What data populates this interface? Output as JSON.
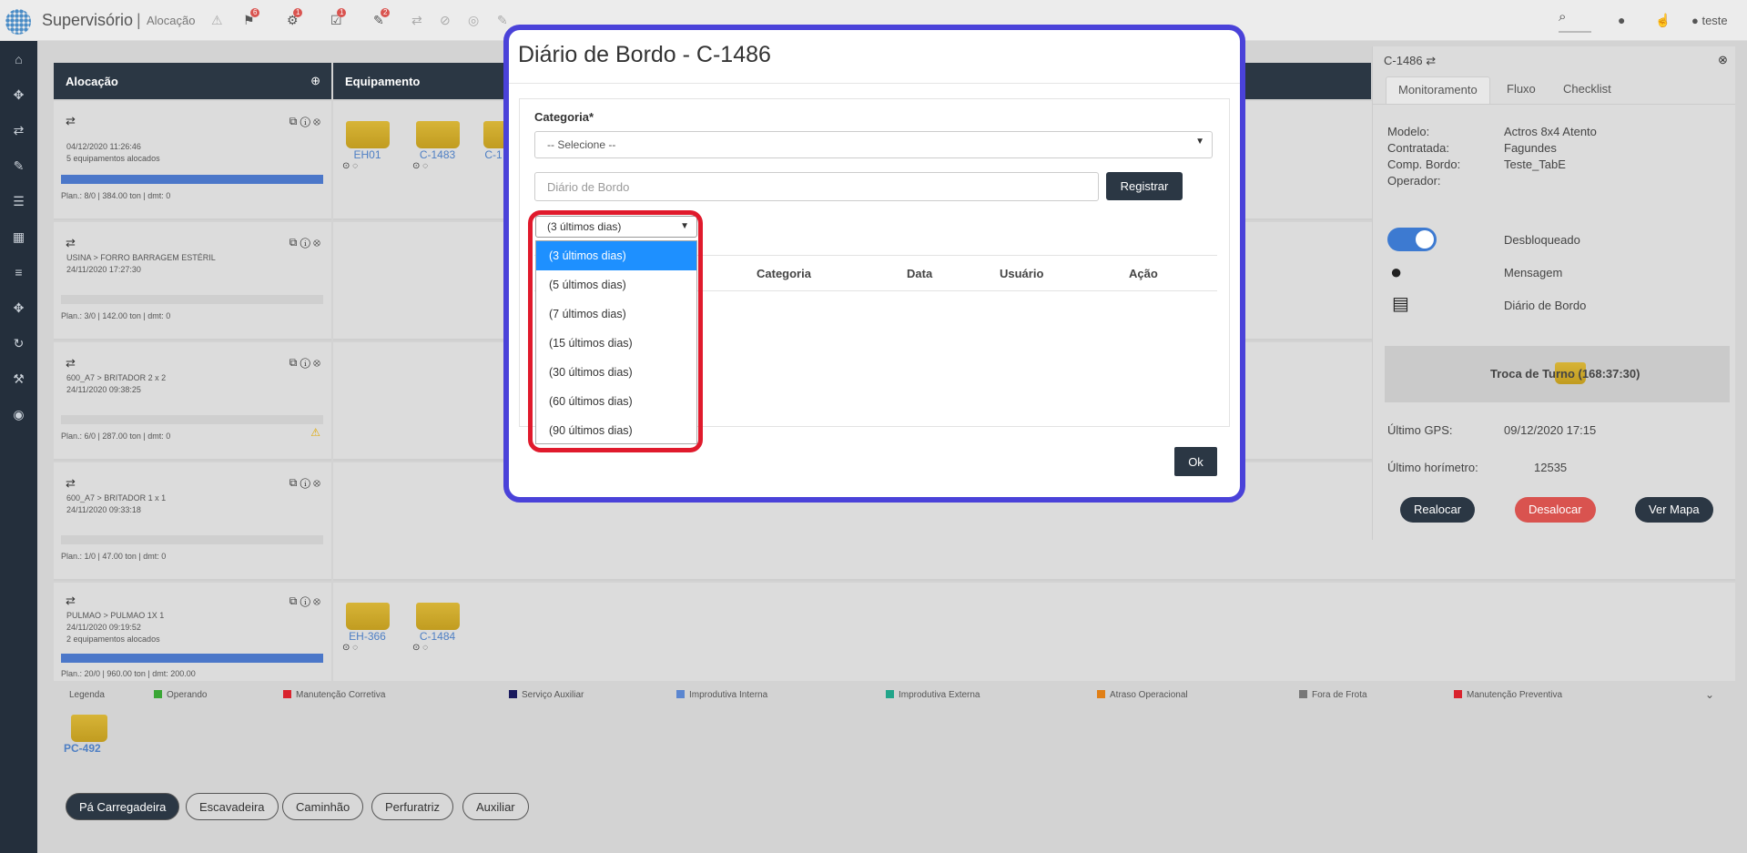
{
  "topbar": {
    "title": "Supervisório",
    "separator": "|",
    "subtitle": "Alocação",
    "badges": [
      "6",
      "1",
      "1",
      "2"
    ],
    "user": "teste"
  },
  "allocation": {
    "header": "Alocação",
    "equipment_header": "Equipamento",
    "rows": [
      {
        "line1": "04/12/2020 11:26:46",
        "line2": "5 equipamentos alocados",
        "plan": "Plan.: 8/0 | 384.00 ton | dmt: 0",
        "progress": 1.0
      },
      {
        "line1": "USINA > FORRO BARRAGEM ESTÉRIL",
        "line2": "24/11/2020 17:27:30",
        "plan": "Plan.: 3/0 | 142.00 ton | dmt: 0",
        "progress": 0
      },
      {
        "line1": "600_A7 > BRITADOR 2 x 2",
        "line2": "24/11/2020 09:38:25",
        "plan": "Plan.: 6/0 | 287.00 ton | dmt: 0",
        "progress": 0
      },
      {
        "line1": "600_A7 > BRITADOR 1 x 1",
        "line2": "24/11/2020 09:33:18",
        "plan": "Plan.: 1/0 | 47.00 ton | dmt: 0",
        "progress": 0
      },
      {
        "line1": "PULMAO > PULMAO 1X 1",
        "line2": "24/11/2020 09:19:52",
        "line3": "2 equipamentos alocados",
        "plan": "Plan.: 20/0 | 960.00 ton | dmt: 200.00",
        "progress": 1.0
      }
    ],
    "row1_equipment": [
      "EH01",
      "C-1483",
      "C-1"
    ],
    "row5_equipment": [
      "EH-366",
      "C-1484"
    ]
  },
  "legend": {
    "title": "Legenda",
    "items": [
      {
        "label": "Operando",
        "color": "#3aa635"
      },
      {
        "label": "Manutenção Corretiva",
        "color": "#d9232d"
      },
      {
        "label": "Serviço Auxiliar",
        "color": "#1a1a5e"
      },
      {
        "label": "Improdutiva Interna",
        "color": "#5b86d0"
      },
      {
        "label": "Improdutiva Externa",
        "color": "#22a58a"
      },
      {
        "label": "Atraso Operacional",
        "color": "#e07f16"
      },
      {
        "label": "Fora de Frota",
        "color": "#777777"
      },
      {
        "label": "Manutenção Preventiva",
        "color": "#d9232d"
      }
    ]
  },
  "unallocated": {
    "label": "PC-492"
  },
  "filters": [
    "Pá Carregadeira",
    "Escavadeira",
    "Caminhão",
    "Perfuratriz",
    "Auxiliar"
  ],
  "right_panel": {
    "title": "C-1486",
    "tabs": [
      "Monitoramento",
      "Fluxo",
      "Checklist"
    ],
    "fields": [
      {
        "label": "Modelo:",
        "value": "Actros 8x4 Atento"
      },
      {
        "label": "Contratada:",
        "value": "Fagundes"
      },
      {
        "label": "Comp. Bordo:",
        "value": "Teste_TabE"
      },
      {
        "label": "Operador:",
        "value": ""
      }
    ],
    "actions": {
      "toggle": "Desbloqueado",
      "message": "Mensagem",
      "diary": "Diário de Bordo"
    },
    "shift": "Troca de Turno (168:37:30)",
    "gps_label": "Último GPS:",
    "gps_value": "09/12/2020 17:15",
    "hour_label": "Último horímetro:",
    "hour_value": "12535",
    "btn_realocar": "Realocar",
    "btn_desalocar": "Desalocar",
    "btn_mapa": "Ver Mapa"
  },
  "modal": {
    "title": "Diário de Bordo - C-1486",
    "category_label": "Categoria*",
    "category_value": "-- Selecione --",
    "diary_placeholder": "Diário de Bordo",
    "register_label": "Registrar",
    "period_value": "(3 últimos dias)",
    "period_options": [
      "(3 últimos dias)",
      "(5 últimos dias)",
      "(7 últimos dias)",
      "(15 últimos dias)",
      "(30 últimos dias)",
      "(60 últimos dias)",
      "(90 últimos dias)"
    ],
    "columns": [
      "Categoria",
      "Data",
      "Usuário",
      "Ação"
    ],
    "ok_label": "Ok"
  },
  "colors": {
    "dark": "#2b3744",
    "accent": "#1e90ff",
    "highlight": "#e01a2c",
    "modal_border": "#4a42d9"
  }
}
